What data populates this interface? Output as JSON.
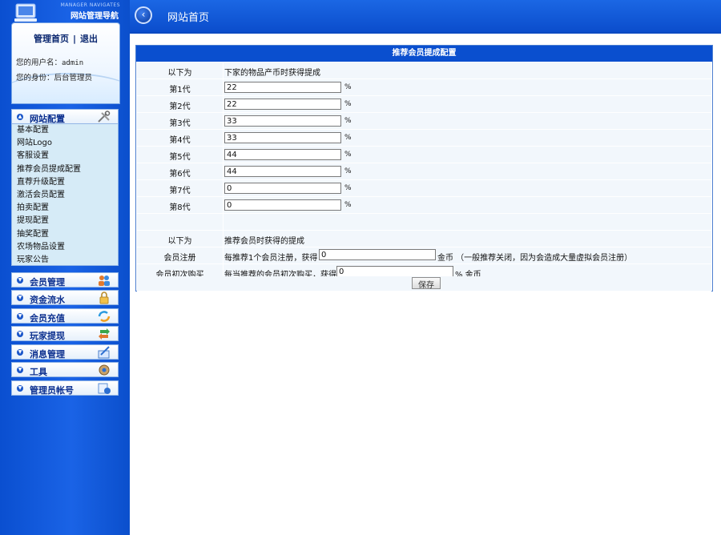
{
  "brand": {
    "subtitle": "MANAGER NAVIGATES",
    "title": "网站管理导航"
  },
  "userbox": {
    "home_link": "管理首页",
    "separator": "|",
    "logout_link": "退出",
    "username_label": "您的用户名：",
    "username": "admin",
    "role_label": "您的身份：",
    "role": "后台管理员"
  },
  "sidebar": {
    "config_head": "网站配置",
    "config_items": [
      "基本配置",
      "网站Logo",
      "客服设置",
      "推荐会员提成配置",
      "直荐升级配置",
      "激活会员配置",
      "拍卖配置",
      "提现配置",
      "抽奖配置",
      "农场物品设置",
      "玩家公告"
    ],
    "sections": [
      {
        "label": "会员管理",
        "icon": "people-icon"
      },
      {
        "label": "资金流水",
        "icon": "lock-icon"
      },
      {
        "label": "会员充值",
        "icon": "refresh-icon"
      },
      {
        "label": "玩家提现",
        "icon": "exchange-icon"
      },
      {
        "label": "消息管理",
        "icon": "message-icon"
      },
      {
        "label": "工具",
        "icon": "tools-icon"
      },
      {
        "label": "管理员帐号",
        "icon": "admin-icon"
      }
    ]
  },
  "topbar": {
    "title": "网站首页"
  },
  "panel": {
    "title": "推荐会员提成配置",
    "intro": {
      "label": "以下为",
      "text": "下家的物品产币时获得提成"
    },
    "generations": [
      {
        "label": "第1代",
        "value": "22",
        "unit": "%"
      },
      {
        "label": "第2代",
        "value": "22",
        "unit": "%"
      },
      {
        "label": "第3代",
        "value": "33",
        "unit": "%"
      },
      {
        "label": "第4代",
        "value": "33",
        "unit": "%"
      },
      {
        "label": "第5代",
        "value": "44",
        "unit": "%"
      },
      {
        "label": "第6代",
        "value": "44",
        "unit": "%"
      },
      {
        "label": "第7代",
        "value": "0",
        "unit": "%"
      },
      {
        "label": "第8代",
        "value": "0",
        "unit": "%"
      }
    ],
    "intro2": {
      "label": "以下为",
      "text": "推荐会员时获得的提成"
    },
    "register": {
      "label": "会员注册",
      "prefix": "每推荐1个会员注册，获得",
      "value": "0",
      "suffix": "金币 （一般推荐关闭，因为会造成大量虚拟会员注册）"
    },
    "first_purchase": {
      "label": "会员初次购买",
      "prefix": "每当推荐的会员初次购买，获得",
      "value": "0",
      "suffix": "% 金币"
    },
    "save_label": "保存"
  }
}
